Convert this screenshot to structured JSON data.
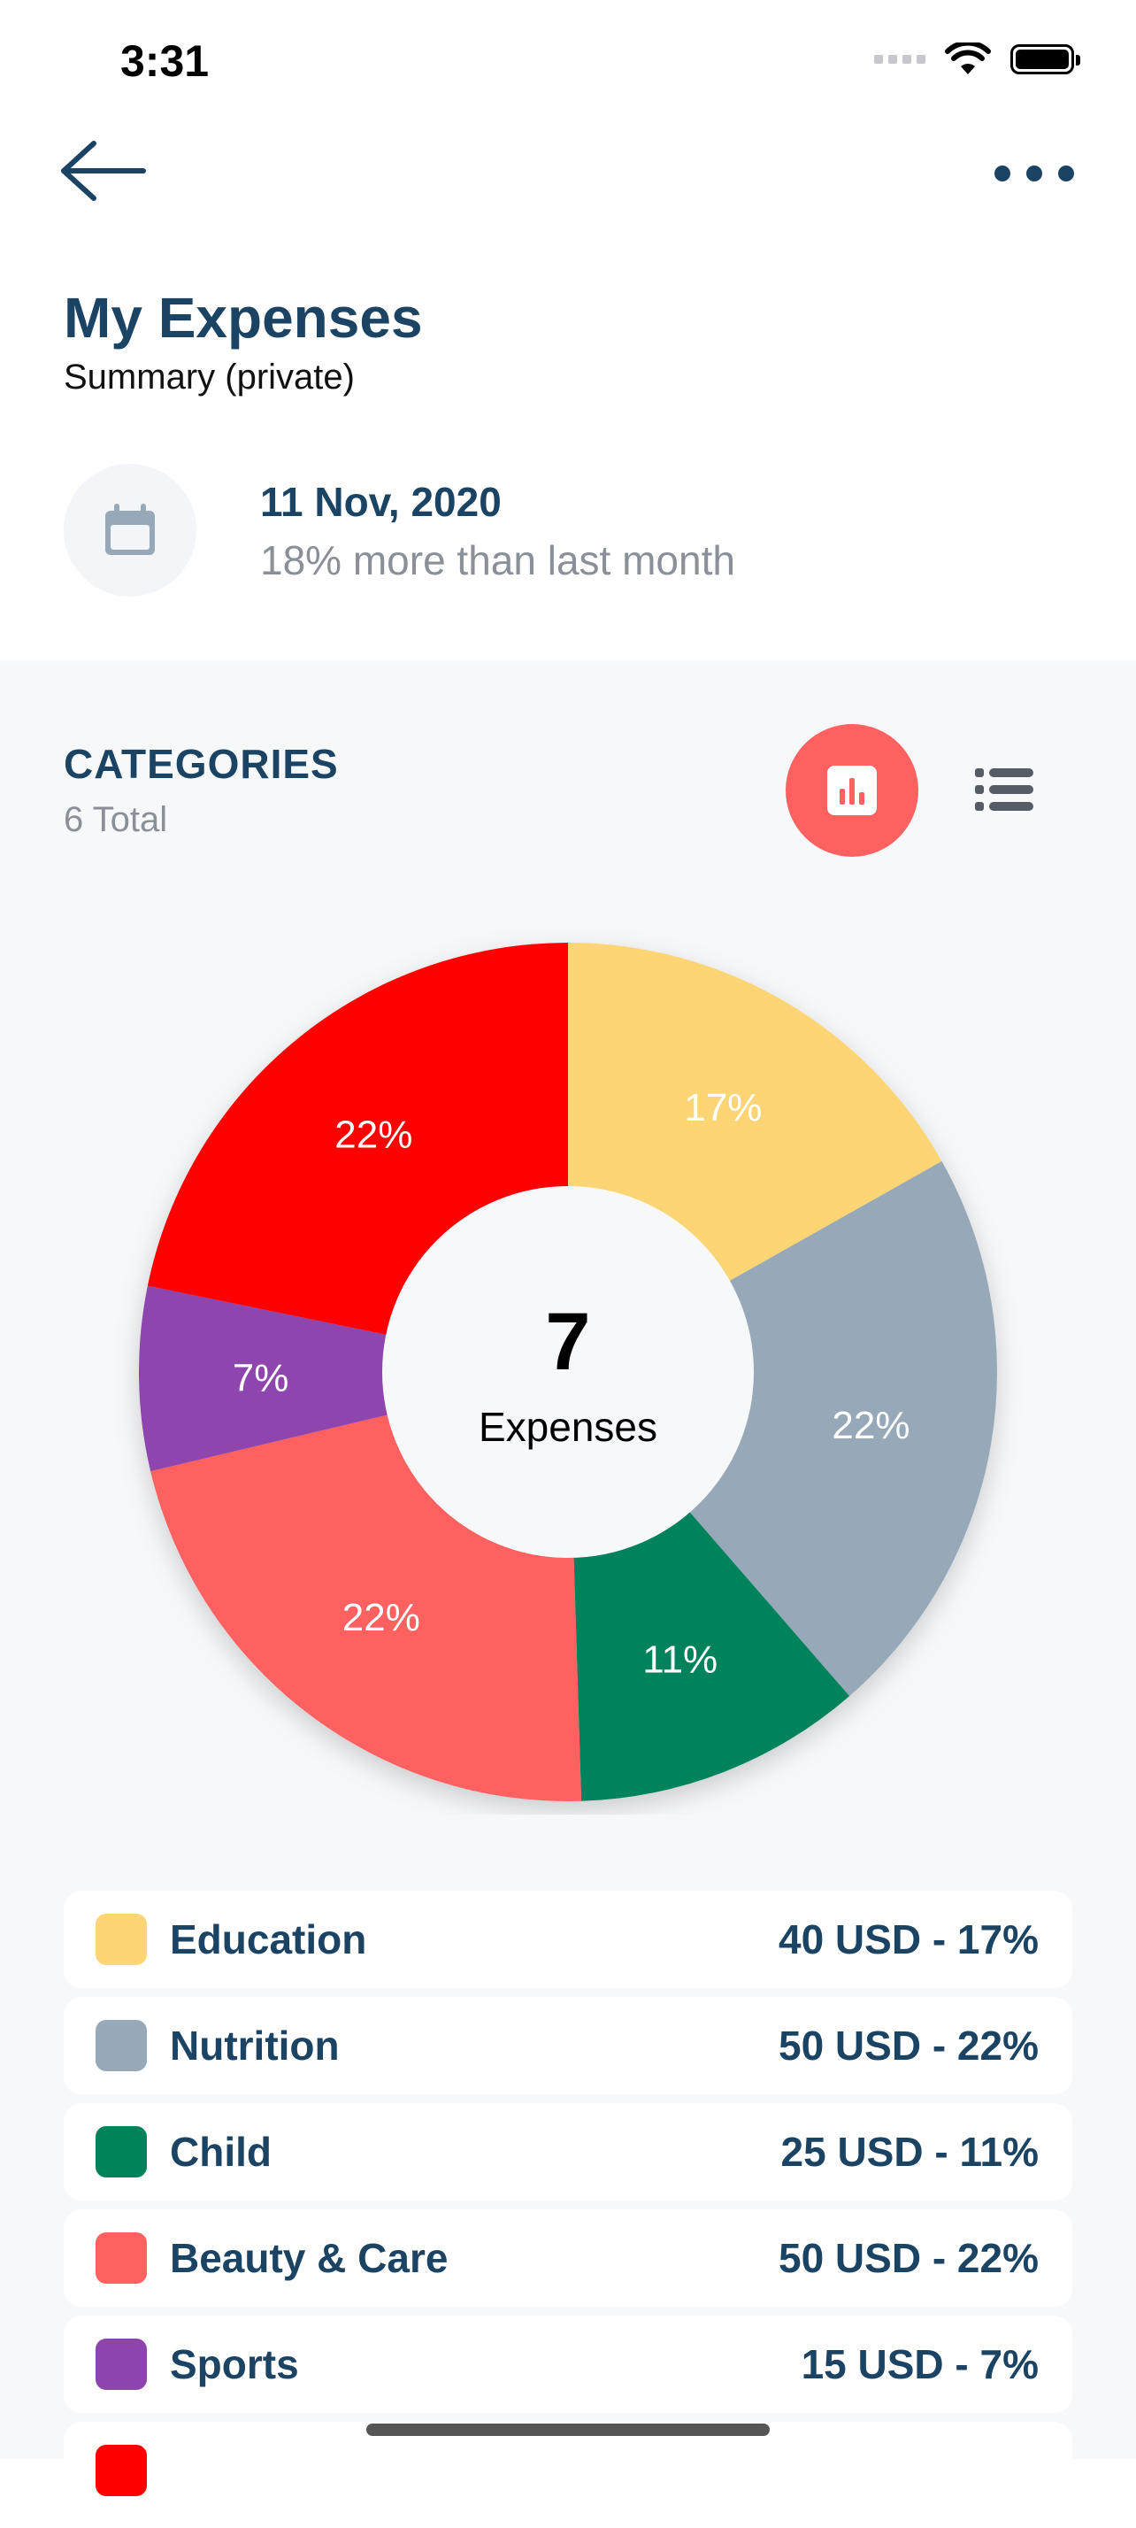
{
  "status": {
    "time": "3:31"
  },
  "header": {
    "title": "My Expenses",
    "subtitle": "Summary (private)"
  },
  "date_block": {
    "date": "11 Nov, 2020",
    "note": "18% more than last month"
  },
  "categories": {
    "title": "CATEGORIES",
    "total": "6 Total"
  },
  "chart_data": {
    "type": "pie",
    "center_value": "7",
    "center_label": "Expenses",
    "slices": [
      {
        "name": "Education",
        "percent": 17,
        "label": "17%",
        "color": "#fdd574"
      },
      {
        "name": "Nutrition",
        "percent": 22,
        "label": "22%",
        "color": "#97a9b8"
      },
      {
        "name": "Child",
        "percent": 11,
        "label": "11%",
        "color": "#00825b"
      },
      {
        "name": "Beauty & Care",
        "percent": 22,
        "label": "22%",
        "color": "#ff6160"
      },
      {
        "name": "Sports",
        "percent": 7,
        "label": "7%",
        "color": "#8e44ad"
      },
      {
        "name": "",
        "percent": 22,
        "label": "22%",
        "color": "#ff0000"
      }
    ]
  },
  "legend": [
    {
      "name": "Education",
      "value": "40 USD - 17%",
      "color": "#fdd574"
    },
    {
      "name": "Nutrition",
      "value": "50 USD - 22%",
      "color": "#97a9b8"
    },
    {
      "name": "Child",
      "value": "25 USD - 11%",
      "color": "#00825b"
    },
    {
      "name": "Beauty & Care",
      "value": "50 USD - 22%",
      "color": "#ff6160"
    },
    {
      "name": "Sports",
      "value": "15 USD - 7%",
      "color": "#8e44ad"
    }
  ],
  "colors": {
    "primary": "#1b4464",
    "accent": "#ff6160"
  }
}
